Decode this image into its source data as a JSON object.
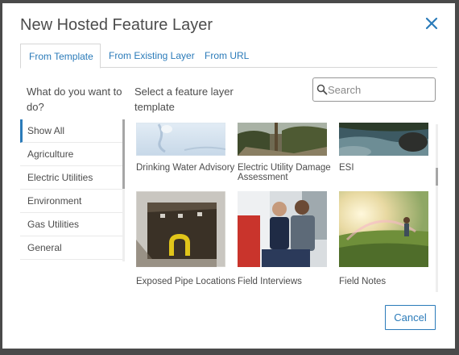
{
  "dialog": {
    "title": "New Hosted Feature Layer",
    "close_icon": "close-icon",
    "accent_color": "#2b7bb9"
  },
  "tabs": [
    {
      "label": "From Template",
      "active": true
    },
    {
      "label": "From Existing Layer",
      "active": false
    },
    {
      "label": "From URL",
      "active": false
    }
  ],
  "left_panel": {
    "question": "What do you want to do?",
    "categories": [
      {
        "label": "Show All",
        "selected": true
      },
      {
        "label": "Agriculture",
        "selected": false
      },
      {
        "label": "Electric Utilities",
        "selected": false
      },
      {
        "label": "Environment",
        "selected": false
      },
      {
        "label": "Gas Utilities",
        "selected": false
      },
      {
        "label": "General",
        "selected": false
      }
    ]
  },
  "right_panel": {
    "heading": "Select a feature layer template",
    "search": {
      "placeholder": "Search",
      "value": "",
      "icon": "search-icon"
    },
    "templates": [
      {
        "label": "Drinking Water Advisory"
      },
      {
        "label": "Electric Utility Damage Assessment"
      },
      {
        "label": "ESI"
      },
      {
        "label": "Exposed Pipe Locations"
      },
      {
        "label": "Field Interviews"
      },
      {
        "label": "Field Notes"
      }
    ]
  },
  "footer": {
    "cancel_label": "Cancel"
  }
}
